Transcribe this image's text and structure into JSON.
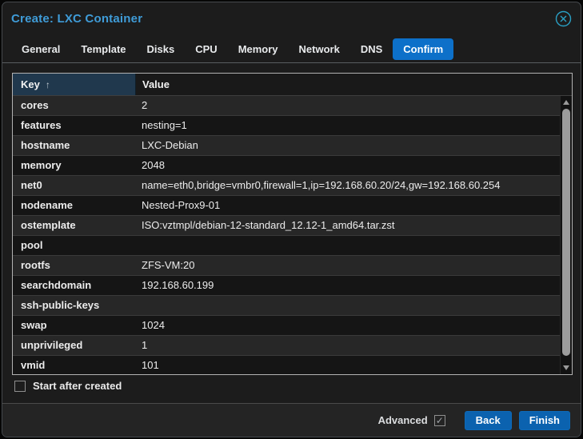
{
  "window": {
    "title": "Create: LXC Container"
  },
  "tabs": [
    {
      "label": "General",
      "active": false
    },
    {
      "label": "Template",
      "active": false
    },
    {
      "label": "Disks",
      "active": false
    },
    {
      "label": "CPU",
      "active": false
    },
    {
      "label": "Memory",
      "active": false
    },
    {
      "label": "Network",
      "active": false
    },
    {
      "label": "DNS",
      "active": false
    },
    {
      "label": "Confirm",
      "active": true
    }
  ],
  "table": {
    "columns": [
      {
        "label": "Key",
        "sorted": "asc"
      },
      {
        "label": "Value",
        "sorted": ""
      }
    ],
    "sort_icon": "↑",
    "rows": [
      {
        "key": "cores",
        "value": "2"
      },
      {
        "key": "features",
        "value": "nesting=1"
      },
      {
        "key": "hostname",
        "value": "LXC-Debian"
      },
      {
        "key": "memory",
        "value": "2048"
      },
      {
        "key": "net0",
        "value": "name=eth0,bridge=vmbr0,firewall=1,ip=192.168.60.20/24,gw=192.168.60.254"
      },
      {
        "key": "nodename",
        "value": "Nested-Prox9-01"
      },
      {
        "key": "ostemplate",
        "value": "ISO:vztmpl/debian-12-standard_12.12-1_amd64.tar.zst"
      },
      {
        "key": "pool",
        "value": ""
      },
      {
        "key": "rootfs",
        "value": "ZFS-VM:20"
      },
      {
        "key": "searchdomain",
        "value": "192.168.60.199"
      },
      {
        "key": "ssh-public-keys",
        "value": ""
      },
      {
        "key": "swap",
        "value": "1024"
      },
      {
        "key": "unprivileged",
        "value": "1"
      },
      {
        "key": "vmid",
        "value": "101"
      }
    ]
  },
  "options": {
    "start_after_created": {
      "label": "Start after created",
      "checked": false
    }
  },
  "footer": {
    "advanced": {
      "label": "Advanced",
      "checked": true
    },
    "back_label": "Back",
    "finish_label": "Finish"
  },
  "icons": {
    "close": "circle-x",
    "check": "✓",
    "sort_asc": "↑",
    "scroll_up": "triangle-up",
    "scroll_down": "triangle-down"
  },
  "colors": {
    "title_text": "#3f9cd8",
    "active_tab": "#0d70c9",
    "button": "#0b62af",
    "header_key_bg": "#20384d",
    "close_icon": "#2aa0c4"
  }
}
